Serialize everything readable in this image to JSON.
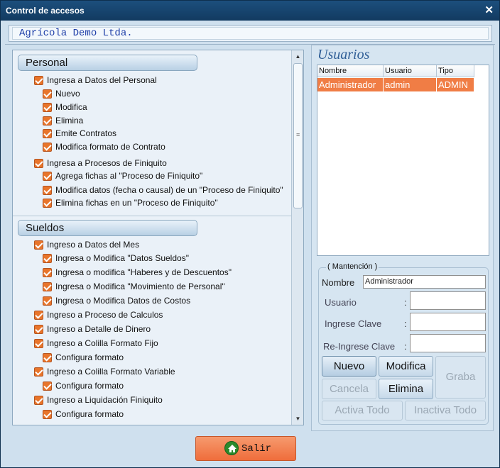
{
  "window": {
    "title": "Control de accesos",
    "close": "✕"
  },
  "company": "Agrícola Demo Ltda.",
  "personal": {
    "header": "Personal",
    "items": [
      "Ingresa a Datos del Personal",
      "Nuevo",
      "Modifica",
      "Elimina",
      "Emite Contratos",
      "Modifica formato de Contrato",
      "Ingresa a Procesos de Finiquito",
      "Agrega fichas al \"Proceso de Finiquito\"",
      "Modifica datos (fecha o causal) de un \"Proceso de Finiquito\"",
      "Elimina fichas en un \"Proceso de Finiquito\""
    ]
  },
  "sueldos": {
    "header": "Sueldos",
    "items": [
      "Ingreso a Datos del Mes",
      "Ingresa o Modifica \"Datos Sueldos\"",
      "Ingresa o modifica \"Haberes y de Descuentos\"",
      "Ingresa o Modifica \"Movimiento de Personal\"",
      "Ingresa o Modifica Datos de Costos",
      "Ingreso a Proceso de Calculos",
      "Ingreso a Detalle de Dinero",
      "Ingreso a Colilla Formato Fijo",
      "Configura formato",
      "Ingreso a Colilla Formato Variable",
      "Configura formato",
      "Ingreso a Liquidación Finiquito",
      "Configura formato"
    ]
  },
  "usuarios": {
    "title": "Usuarios",
    "columns": [
      "Nombre",
      "Usuario",
      "Tipo"
    ],
    "rows": [
      {
        "nombre": "Administrador",
        "usuario": "admin",
        "tipo": "ADMIN"
      }
    ]
  },
  "mantencion": {
    "legend": "( Mantención )",
    "nombre_label": "Nombre",
    "nombre_value": "Administrador",
    "usuario_label": "Usuario",
    "clave_label": "Ingrese Clave",
    "reclave_label": "Re-Ingrese Clave",
    "colon": ":",
    "btn_nuevo": "Nuevo",
    "btn_modifica": "Modifica",
    "btn_graba": "Graba",
    "btn_cancela": "Cancela",
    "btn_elimina": "Elimina",
    "btn_activa": "Activa Todo",
    "btn_inactiva": "Inactiva Todo"
  },
  "footer": {
    "salir": "Salir",
    "icon": "home-icon"
  },
  "colors": {
    "accent": "#ef6d3b",
    "titlebar": "#1c4f7d",
    "text_blue": "#1e3ea8"
  }
}
